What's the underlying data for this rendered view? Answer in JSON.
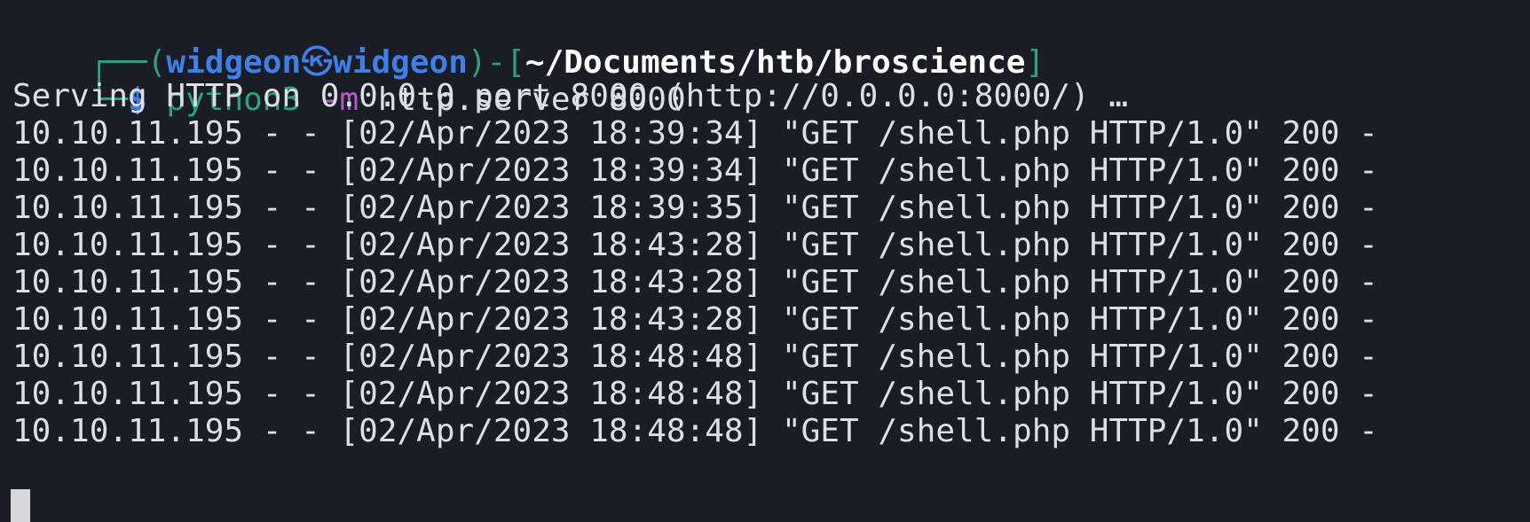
{
  "prompt": {
    "box_top": "┌──",
    "open_paren": "(",
    "user": "widgeon",
    "at_symbol": "㉿",
    "host": "widgeon",
    "close_bracket_open": ")-[",
    "cwd": "~/Documents/htb/broscience",
    "close_bracket": "]",
    "box_bottom": "└─",
    "dollar": "$ ",
    "command": "python3",
    "flag": "-m",
    "args": " http.server 8000"
  },
  "serving_line": "Serving HTTP on 0.0.0.0 port 8000 (http://0.0.0.0:8000/) …",
  "log_lines": [
    "10.10.11.195 - - [02/Apr/2023 18:39:34] \"GET /shell.php HTTP/1.0\" 200 -",
    "10.10.11.195 - - [02/Apr/2023 18:39:34] \"GET /shell.php HTTP/1.0\" 200 -",
    "10.10.11.195 - - [02/Apr/2023 18:39:35] \"GET /shell.php HTTP/1.0\" 200 -",
    "10.10.11.195 - - [02/Apr/2023 18:43:28] \"GET /shell.php HTTP/1.0\" 200 -",
    "10.10.11.195 - - [02/Apr/2023 18:43:28] \"GET /shell.php HTTP/1.0\" 200 -",
    "10.10.11.195 - - [02/Apr/2023 18:43:28] \"GET /shell.php HTTP/1.0\" 200 -",
    "10.10.11.195 - - [02/Apr/2023 18:48:48] \"GET /shell.php HTTP/1.0\" 200 -",
    "10.10.11.195 - - [02/Apr/2023 18:48:48] \"GET /shell.php HTTP/1.0\" 200 -",
    "10.10.11.195 - - [02/Apr/2023 18:48:48] \"GET /shell.php HTTP/1.0\" 200 -"
  ],
  "colors": {
    "background": "#1a1d26",
    "text": "#dcdfe4",
    "prompt_blue": "#3f7fe8",
    "prompt_green": "#2f9e83",
    "flag_purple": "#b05bc4"
  }
}
